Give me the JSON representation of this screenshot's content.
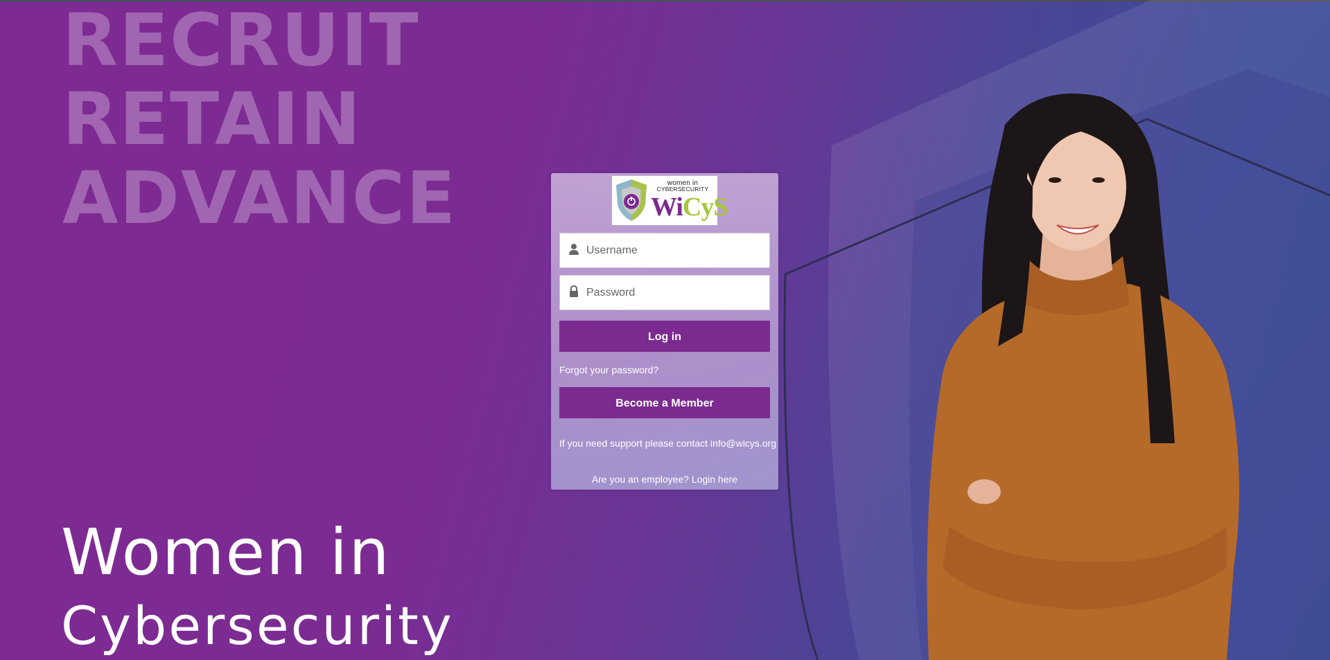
{
  "hero": {
    "headline_lines": [
      "RECRUIT",
      "RETAIN",
      "ADVANCE"
    ],
    "tagline_line1": "Women in",
    "tagline_line2": "Cybersecurity"
  },
  "logo": {
    "top_line1": "women in",
    "top_line2": "CYBERSECURITY",
    "wordmark": "WiCyS"
  },
  "login": {
    "username_placeholder": "Username",
    "password_placeholder": "Password",
    "login_label": "Log in",
    "forgot_label": "Forgot your password?",
    "member_label": "Become a Member",
    "support_text": "If you need support please contact info@wicys.org",
    "employee_text": "Are you an employee?",
    "employee_link": "Login here"
  },
  "icons": {
    "username": "user-icon",
    "password": "lock-icon"
  },
  "colors": {
    "brand_purple": "#7b2a8f",
    "brand_green": "#a6c63a",
    "background_start": "#7e2a93",
    "background_end": "#3a4a96"
  }
}
